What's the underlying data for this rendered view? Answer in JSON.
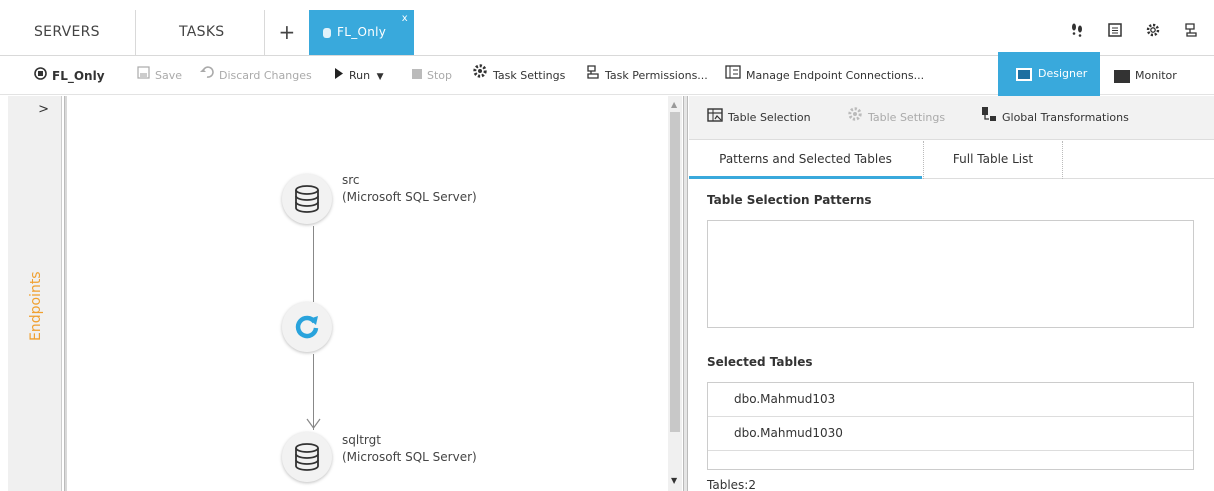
{
  "top_tabs": {
    "servers": "SERVERS",
    "tasks": "TASKS",
    "plus": "+",
    "active_task": "FL_Only",
    "close": "x"
  },
  "top_icons": [
    "footprints-icon",
    "log-icon",
    "settings-icon",
    "permissions-icon"
  ],
  "toolbar": {
    "task_name": "FL_Only",
    "save": "Save",
    "discard": "Discard Changes",
    "run": "Run",
    "stop": "Stop",
    "task_settings": "Task Settings",
    "task_permissions": "Task Permissions...",
    "manage_endpoints": "Manage Endpoint Connections...",
    "designer": "Designer",
    "monitor": "Monitor"
  },
  "left_panel": {
    "chevron": ">",
    "label": "Endpoints"
  },
  "canvas": {
    "source": {
      "name": "src",
      "type": "(Microsoft SQL Server)"
    },
    "target": {
      "name": "sqltrgt",
      "type": "(Microsoft SQL Server)"
    }
  },
  "right_panel": {
    "tools": {
      "table_selection": "Table Selection",
      "table_settings": "Table Settings",
      "global_transformations": "Global Transformations"
    },
    "tabs": {
      "patterns": "Patterns and Selected Tables",
      "full_list": "Full Table List"
    },
    "patterns_title": "Table Selection Patterns",
    "selected_title": "Selected Tables",
    "selected_tables": [
      "dbo.Mahmud103",
      "dbo.Mahmud1030"
    ],
    "tables_count": "Tables:2"
  },
  "colors": {
    "accent": "#39a9dc",
    "endpoints_label": "#f0a030"
  }
}
